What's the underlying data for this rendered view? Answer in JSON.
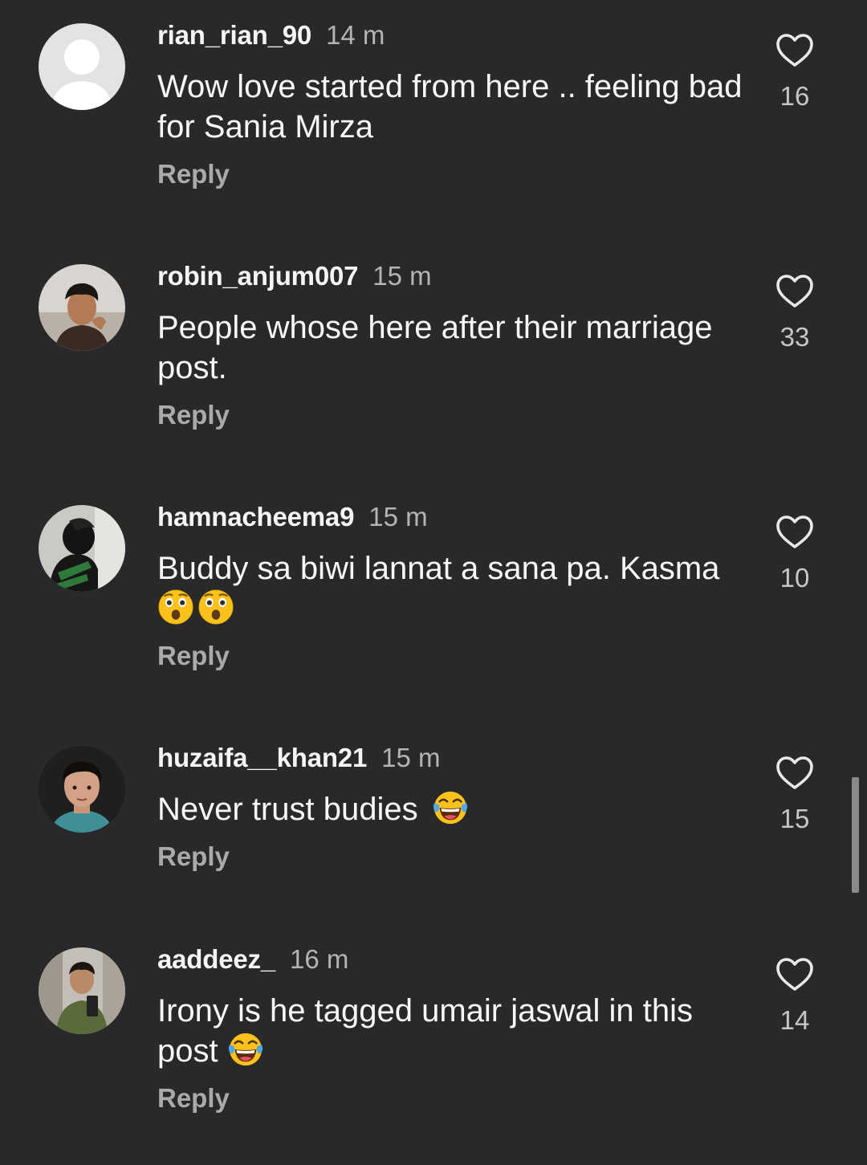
{
  "colors": {
    "background": "#29292b",
    "text": "#f7f7f7",
    "muted": "#b4b4b4",
    "reply": "#aaaaaa"
  },
  "comments": [
    {
      "username": "rian_rian_90",
      "time": "14 m",
      "text_parts": [
        "Wow love  started from here .. feeling bad for Sania Mirza"
      ],
      "emoji": "none",
      "reply_label": "Reply",
      "likes": "16",
      "avatar": "default-avatar-icon"
    },
    {
      "username": "robin_anjum007",
      "time": "15 m",
      "text_parts": [
        "People whose here after their marriage post."
      ],
      "emoji": "none",
      "reply_label": "Reply",
      "likes": "33",
      "avatar": "user-photo"
    },
    {
      "username": "hamnacheema9",
      "time": "15 m",
      "text_parts": [
        "Buddy sa biwi lannat a sana pa. Kasma "
      ],
      "emoji": "astonished-face x2",
      "reply_label": "Reply",
      "likes": "10",
      "avatar": "user-photo"
    },
    {
      "username": "huzaifa__khan21",
      "time": "15 m",
      "text_parts": [
        "Never trust budies "
      ],
      "emoji": "tears-of-joy",
      "reply_label": "Reply",
      "likes": "15",
      "avatar": "user-photo"
    },
    {
      "username": "aaddeez_",
      "time": "16 m",
      "text_parts": [
        "Irony is he tagged umair jaswal in this post "
      ],
      "emoji": "tears-of-joy",
      "reply_label": "Reply",
      "likes": "14",
      "avatar": "user-photo"
    }
  ]
}
